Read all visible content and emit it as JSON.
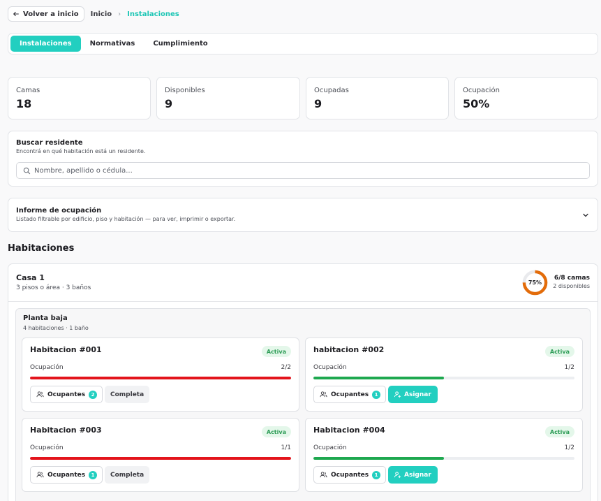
{
  "breadcrumb": {
    "back_label": "Volver a inicio",
    "home": "Inicio",
    "separator": "›",
    "current": "Instalaciones"
  },
  "tabs": [
    {
      "label": "Instalaciones",
      "active": true
    },
    {
      "label": "Normativas",
      "active": false
    },
    {
      "label": "Cumplimiento",
      "active": false
    }
  ],
  "stats": [
    {
      "label": "Camas",
      "value": "18"
    },
    {
      "label": "Disponibles",
      "value": "9"
    },
    {
      "label": "Ocupadas",
      "value": "9"
    },
    {
      "label": "Ocupación",
      "value": "50%"
    }
  ],
  "search": {
    "title": "Buscar residente",
    "subtitle": "Encontrá en qué habitación está un residente.",
    "placeholder": "Nombre, apellido o cédula..."
  },
  "report": {
    "title": "Informe de ocupación",
    "subtitle": "Listado filtrable por edificio, piso y habitación — para ver, imprimir o exportar."
  },
  "rooms_section_title": "Habitaciones",
  "house": {
    "name": "Casa 1",
    "details": "3 pisos o área · 3 baños",
    "occupancy_percent": "75%",
    "occupancy_fraction": 0.75,
    "beds": "6/8 camas",
    "available": "2 disponibles",
    "floor": {
      "name": "Planta baja",
      "details": "4 habitaciones · 1 baño",
      "rooms": [
        {
          "name": "Habitacion #001",
          "status": "Activa",
          "occ_label": "Ocupación",
          "occ": "2/2",
          "fraction": 1.0,
          "occupants_label": "Ocupantes",
          "occupants": "2",
          "action": "Completa",
          "full": true
        },
        {
          "name": "habitacion #002",
          "status": "Activa",
          "occ_label": "Ocupación",
          "occ": "1/2",
          "fraction": 0.5,
          "occupants_label": "Ocupantes",
          "occupants": "1",
          "action": "Asignar",
          "full": false
        },
        {
          "name": "Habitacion #003",
          "status": "Activa",
          "occ_label": "Ocupación",
          "occ": "1/1",
          "fraction": 1.0,
          "occupants_label": "Ocupantes",
          "occupants": "1",
          "action": "Completa",
          "full": true
        },
        {
          "name": "Habitacion #004",
          "status": "Activa",
          "occ_label": "Ocupación",
          "occ": "1/2",
          "fraction": 0.5,
          "occupants_label": "Ocupantes",
          "occupants": "1",
          "action": "Asignar",
          "full": false
        }
      ]
    }
  },
  "colors": {
    "accent": "#22cfc0",
    "full_bar": "#e3141c",
    "partial_bar": "#1ea84f",
    "donut": "#e36c0a"
  }
}
